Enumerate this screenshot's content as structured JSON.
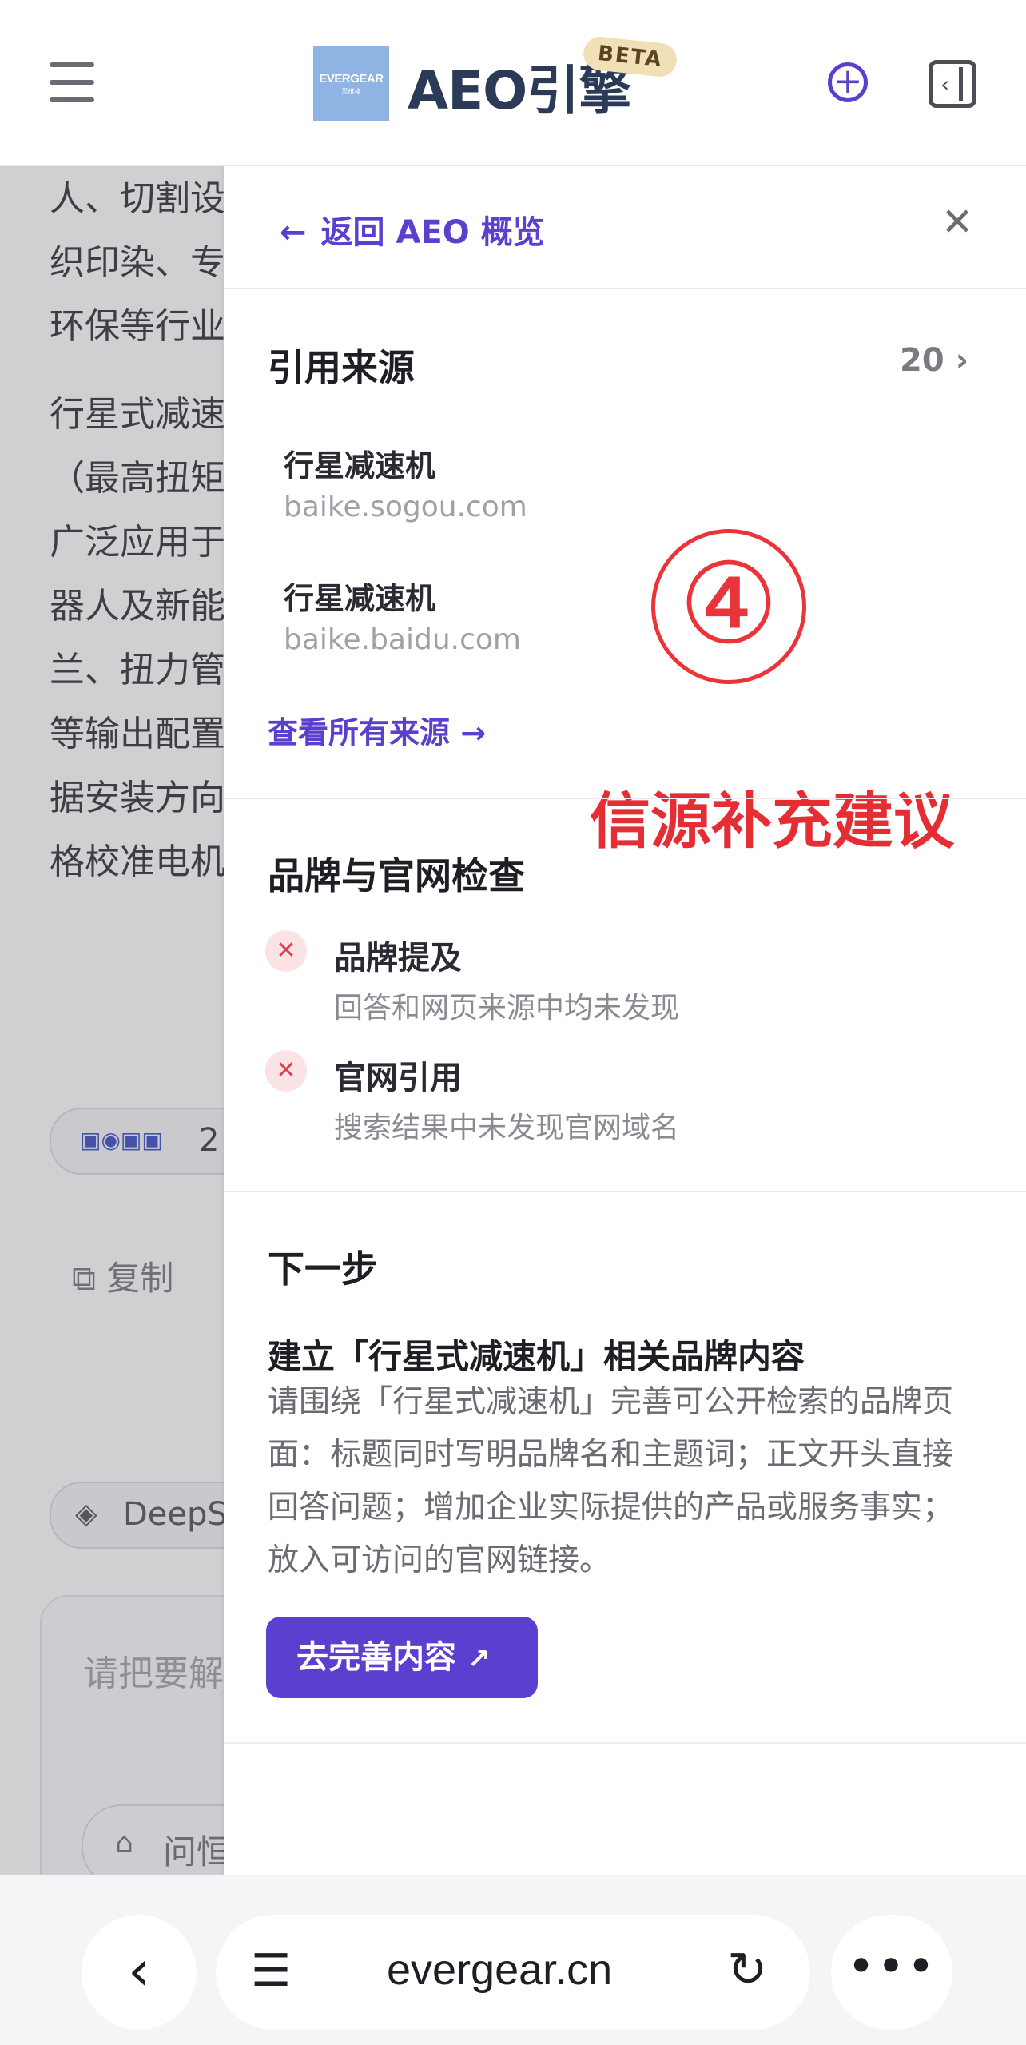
{
  "header": {
    "logo_text": "EVERGEAR",
    "logo_sub": "爱维格",
    "title": "AEO引擎",
    "badge": "BETA",
    "accent": "#5b3fcf"
  },
  "background": {
    "lines": [
      "人、切割设",
      "织印染、专",
      "环保等行业",
      "行星式减速",
      "（最高扭矩",
      "广泛应用于",
      "器人及新能",
      "兰、扭力管",
      "等输出配置",
      "据安装方向",
      "格校准电机"
    ],
    "source_count": "2",
    "copy_label": "复制",
    "model_label": "DeepS",
    "input_placeholder": "请把要解",
    "chip_label": "问恒"
  },
  "drawer": {
    "back_label": "返回 AEO 概览",
    "sources": {
      "title": "引用来源",
      "count": "20",
      "items": [
        {
          "title": "行星减速机",
          "domain": "baike.sogou.com"
        },
        {
          "title": "行星减速机",
          "domain": "baike.baidu.com"
        }
      ],
      "view_all": "查看所有来源"
    },
    "annotation": {
      "number": "④",
      "text": "信源补充建议",
      "color": "#e52e33"
    },
    "brand_check": {
      "title": "品牌与官网检查",
      "items": [
        {
          "title": "品牌提及",
          "desc": "回答和网页来源中均未发现",
          "status": "fail"
        },
        {
          "title": "官网引用",
          "desc": "搜索结果中未发现官网域名",
          "status": "fail"
        }
      ]
    },
    "next_step": {
      "title": "下一步",
      "heading": "建立「行星式减速机」相关品牌内容",
      "desc": "请围绕「行星式减速机」完善可公开检索的品牌页面：标题同时写明品牌名和主题词；正文开头直接回答问题；增加企业实际提供的产品或服务事实；放入可访问的官网链接。",
      "cta": "去完善内容"
    }
  },
  "browser": {
    "url": "evergear.cn"
  }
}
